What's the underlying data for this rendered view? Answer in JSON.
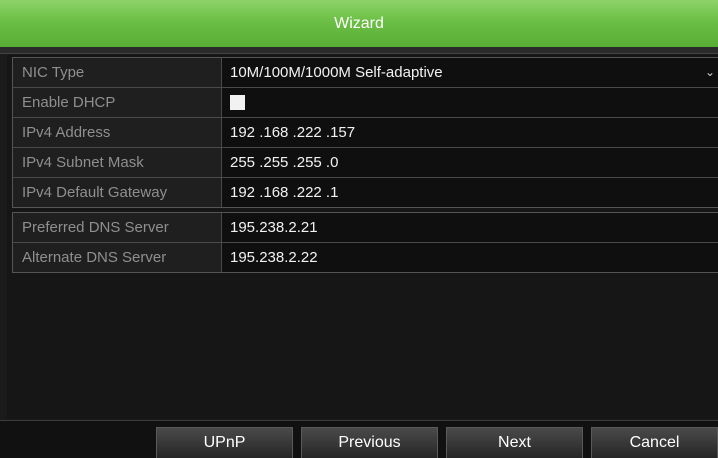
{
  "window": {
    "title": "Wizard"
  },
  "network_group": [
    {
      "label": "NIC Type",
      "value": "10M/100M/1000M Self-adaptive",
      "type": "select"
    },
    {
      "label": "Enable DHCP",
      "checked": false,
      "type": "checkbox"
    },
    {
      "label": "IPv4 Address",
      "value": "192 .168 .222 .157",
      "type": "text"
    },
    {
      "label": "IPv4 Subnet Mask",
      "value": "255 .255 .255 .0",
      "type": "text"
    },
    {
      "label": "IPv4 Default Gateway",
      "value": "192 .168 .222 .1",
      "type": "text"
    }
  ],
  "dns_group": [
    {
      "label": "Preferred DNS Server",
      "value": "195.238.2.21"
    },
    {
      "label": "Alternate DNS Server",
      "value": "195.238.2.22"
    }
  ],
  "buttons": {
    "upnp": "UPnP",
    "previous": "Previous",
    "next": "Next",
    "cancel": "Cancel"
  },
  "colors": {
    "title_bar": "#6cbf45",
    "background": "#1b1b1b",
    "label_text": "#8f8f8f",
    "value_text": "#f2f2f2"
  }
}
